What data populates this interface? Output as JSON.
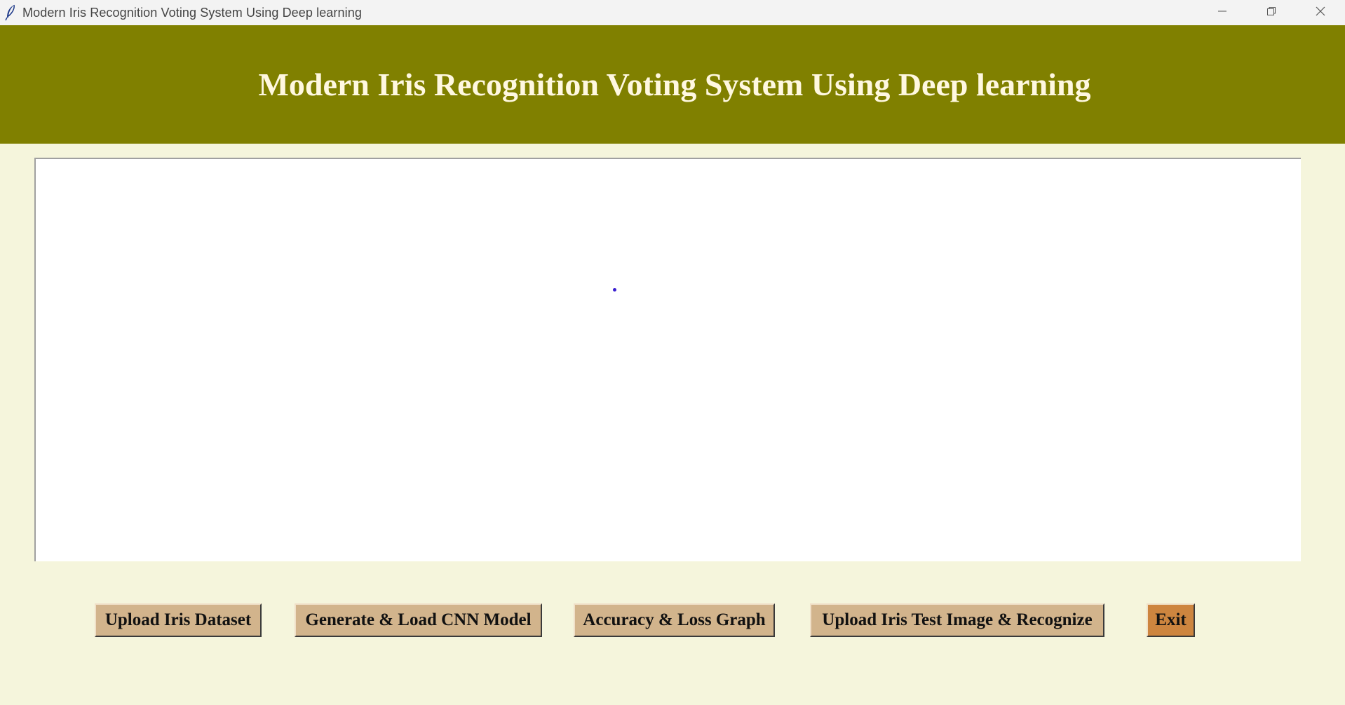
{
  "window": {
    "title": "Modern Iris Recognition Voting System Using Deep learning"
  },
  "banner": {
    "title": "Modern Iris Recognition Voting System Using Deep learning"
  },
  "output": {
    "text": ""
  },
  "buttons": {
    "upload_dataset": "Upload Iris Dataset",
    "generate_model": "Generate & Load CNN Model",
    "graph": "Accuracy & Loss Graph",
    "upload_test": "Upload Iris Test Image & Recognize",
    "exit": "Exit"
  },
  "colors": {
    "banner_bg": "#808000",
    "window_bg": "#f5f5dc",
    "button_bg": "#d2b48c",
    "exit_bg": "#cd853f"
  },
  "icons": {
    "app": "feather-icon",
    "minimize": "minimize-icon",
    "restore": "restore-icon",
    "close": "close-icon"
  }
}
